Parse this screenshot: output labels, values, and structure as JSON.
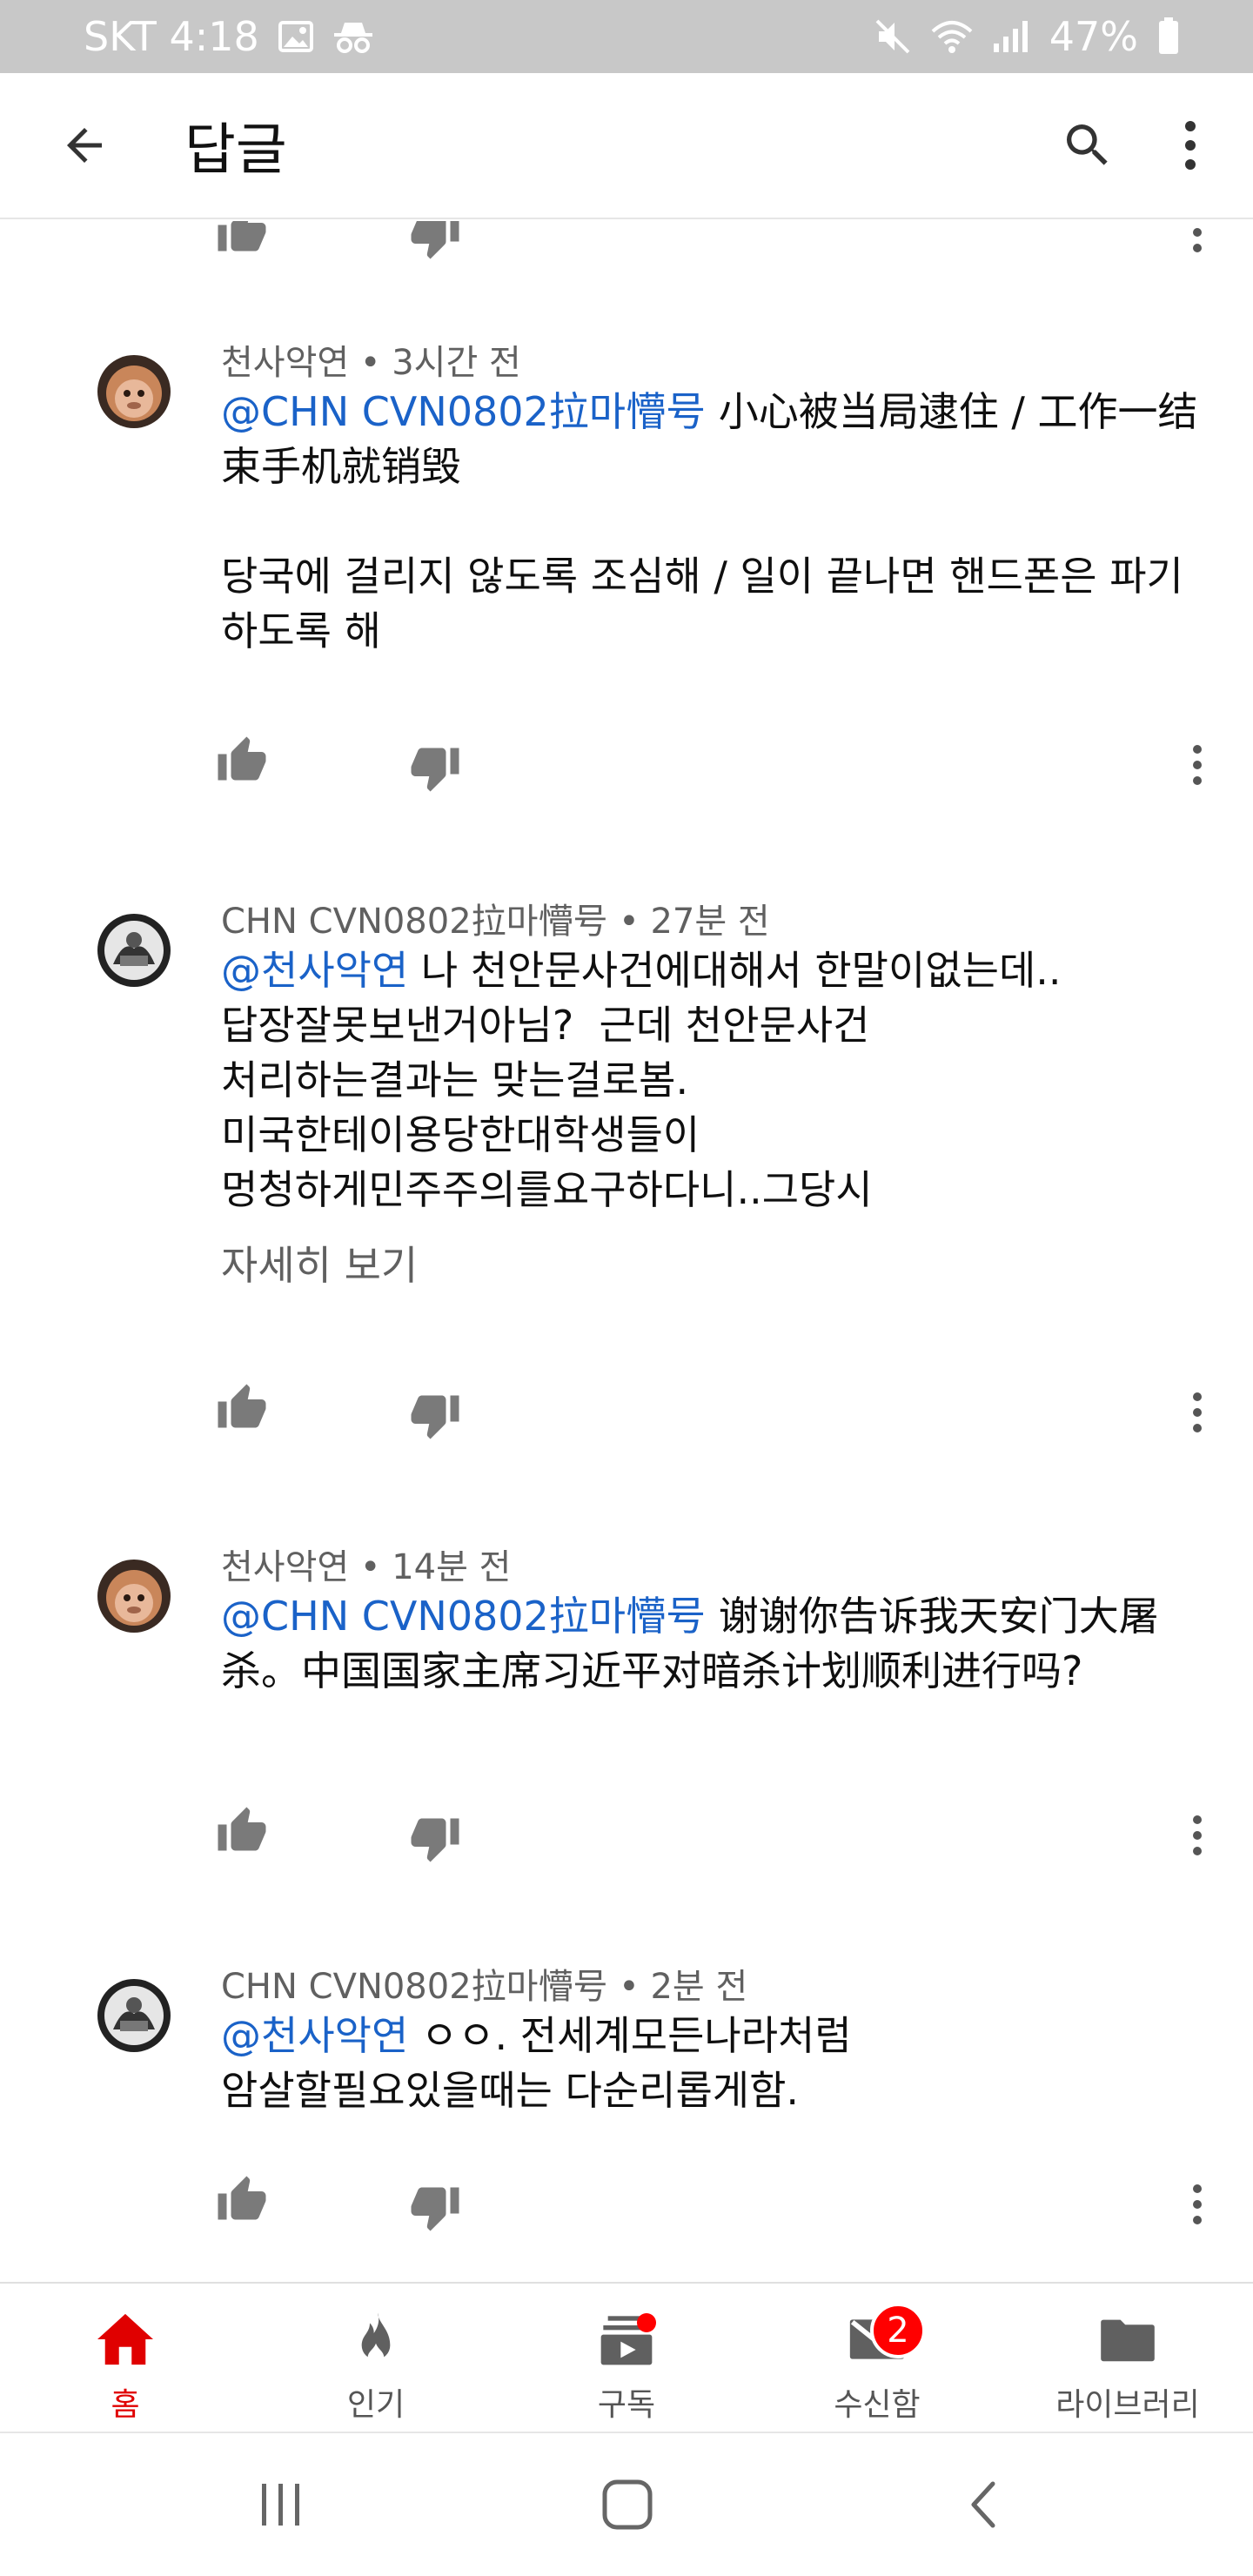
{
  "status_bar": {
    "carrier_time": "SKT 4:18",
    "battery": "47%",
    "icons": [
      "image-icon",
      "incognito-icon",
      "mute-icon",
      "wifi-icon",
      "signal-icon",
      "battery-icon"
    ]
  },
  "app_bar": {
    "title": "답글",
    "back_icon": "arrow-back-icon",
    "search_icon": "search-icon",
    "more_icon": "more-vert-icon"
  },
  "comments": [
    {
      "author": "천사악연",
      "time": "3시간 전",
      "meta": "천사악연 • 3시간 전",
      "mention": "@CHN CVN0802拉마懵号",
      "text_after_mention": " 小心被当局逮住 / 工作一结束手机就销毁\n\n당국에 걸리지 않도록 조심해 / 일이 끝나면 핸드폰은 파기하도록 해",
      "avatar": "monkey-avatar"
    },
    {
      "author": "CHN CVN0802拉마懵号",
      "time": "27분 전",
      "meta": "CHN CVN0802拉마懵号 • 27분 전",
      "mention": "@천사악연",
      "text_after_mention": " 나 천안문사건에대해서 한말이없는데..\n답장잘못보낸거아님?  근데 천안문사건\n처리하는결과는 맞는걸로봄.\n미국한테이용당한대학생들이\n멍청하게민주주의를요구하다니..그당시",
      "read_more": "자세히 보기",
      "avatar": "bw-photo-avatar"
    },
    {
      "author": "천사악연",
      "time": "14분 전",
      "meta": "천사악연 • 14분 전",
      "mention": "@CHN CVN0802拉마懵号",
      "text_after_mention": " 谢谢你告诉我天安门大屠杀。中国国家主席习近平对暗杀计划顺利进行吗?",
      "avatar": "monkey-avatar"
    },
    {
      "author": "CHN CVN0802拉마懵号",
      "time": "2분 전",
      "meta": "CHN CVN0802拉마懵号 • 2분 전",
      "mention": "@천사악연",
      "text_after_mention": " ㅇㅇ. 전세계모든나라처럼\n암살할필요있을때는 다순리롭게함.",
      "avatar": "bw-photo-avatar"
    }
  ],
  "bottom_nav": {
    "items": [
      {
        "label": "홈",
        "icon": "home-icon",
        "active": true
      },
      {
        "label": "인기",
        "icon": "flame-icon"
      },
      {
        "label": "구독",
        "icon": "subscriptions-icon",
        "dot": true
      },
      {
        "label": "수신함",
        "icon": "mail-icon",
        "badge": "2"
      },
      {
        "label": "라이브러리",
        "icon": "folder-icon"
      }
    ]
  },
  "colors": {
    "mention": "#1a62c8",
    "accent_red": "#ff0000",
    "status_bar_bg": "#c8c8c8"
  }
}
